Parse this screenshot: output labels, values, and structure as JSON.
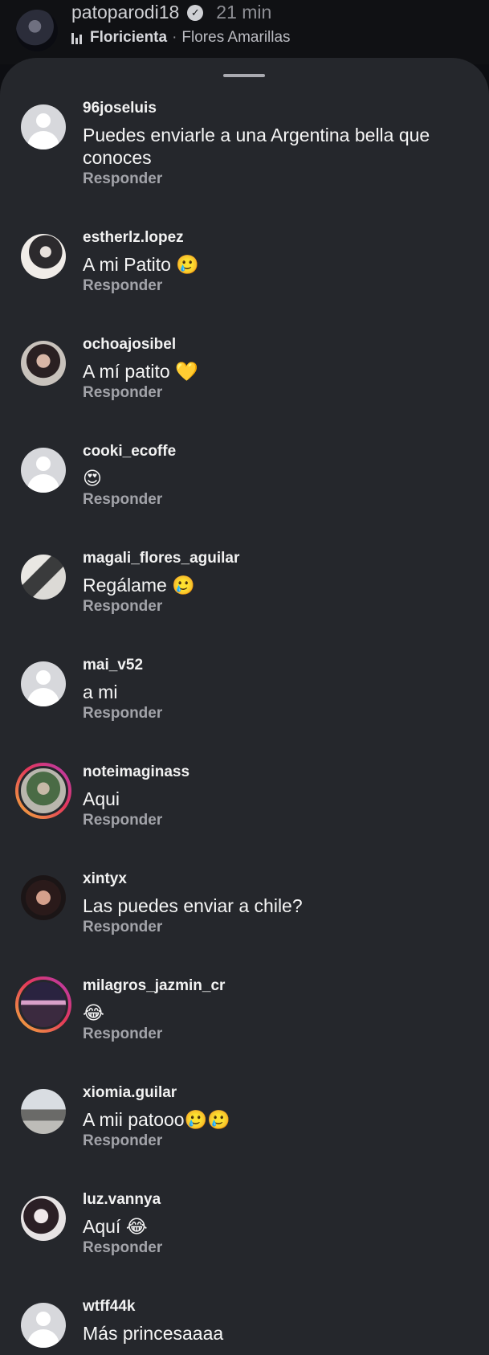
{
  "header": {
    "username": "patoparodi18",
    "time": "21 min",
    "music_title": "Floricienta",
    "music_separator": "·",
    "music_artist": "Flores Amarillas",
    "verified_glyph": "✓"
  },
  "comments": [
    {
      "username": "96joseluis",
      "text": "Puedes enviarle a una Argentina bella que conoces",
      "reply": "Responder",
      "avatar": "default"
    },
    {
      "username": "esther​lz.lopez",
      "text": "A mi Patito 🥲",
      "reply": "Responder",
      "avatar": "photo"
    },
    {
      "username": "ochoajosibel",
      "text": "A mí patito 💛",
      "reply": "Responder",
      "avatar": "photo"
    },
    {
      "username": "cooki_ecoffe",
      "text": "😍",
      "reply": "Responder",
      "avatar": "default"
    },
    {
      "username": "magali_flores_aguilar",
      "text": "Regálame 🥲",
      "reply": "Responder",
      "avatar": "photo"
    },
    {
      "username": "mai_v52",
      "text": "a mi",
      "reply": "Responder",
      "avatar": "default"
    },
    {
      "username": "noteimaginass",
      "text": "Aqui",
      "reply": "Responder",
      "avatar": "story"
    },
    {
      "username": "xintyx",
      "text": "Las puedes enviar a chile?",
      "reply": "Responder",
      "avatar": "photo"
    },
    {
      "username": "milagros_jazmin_cr",
      "text": "😂",
      "reply": "Responder",
      "avatar": "story"
    },
    {
      "username": "xiomia.guilar",
      "text": "A mii  patooo🥲🥲",
      "reply": "Responder",
      "avatar": "photo"
    },
    {
      "username": "luz.vannya",
      "text": "Aquí 😂",
      "reply": "Responder",
      "avatar": "photo"
    },
    {
      "username": "wtff44k",
      "text": "Más princesaaaa",
      "reply": "",
      "avatar": "default"
    }
  ]
}
